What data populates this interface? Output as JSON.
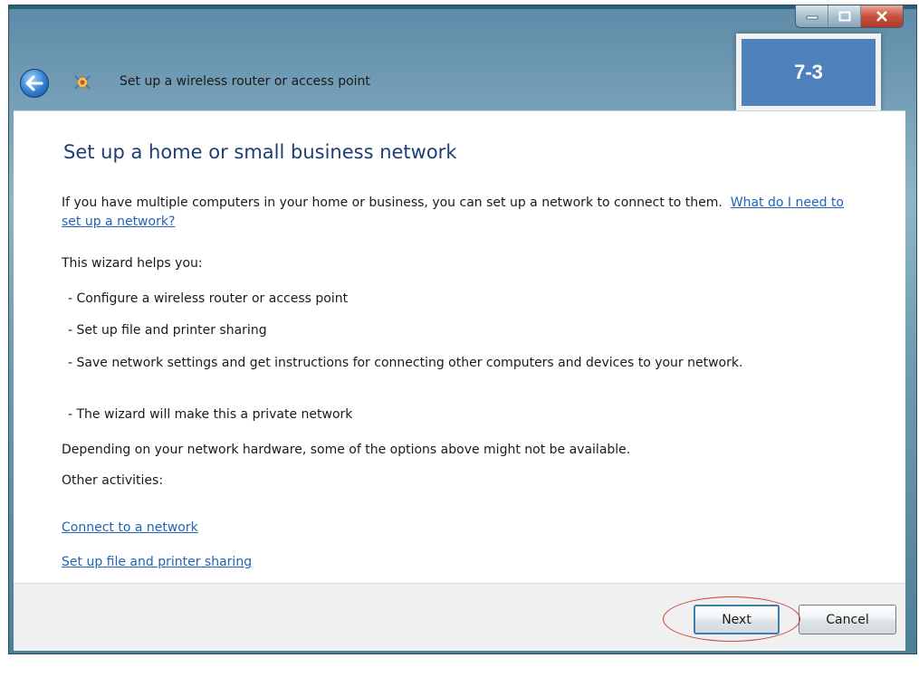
{
  "window": {
    "title": "Set up a wireless router or access point",
    "badge_label": "7-3"
  },
  "content": {
    "heading": "Set up a home or small business network",
    "intro": "If you have multiple computers in your home or business, you can set up a network to connect to them.",
    "intro_link": "What do I need to set up a network?",
    "helps_label": "This wizard helps you:",
    "bullets": [
      "- Configure a wireless router or access point",
      "- Set up file and printer sharing",
      "- Save network settings and get instructions for connecting other computers and devices to your network.",
      "- The wizard will make this a private network"
    ],
    "note": "Depending on your network hardware, some of the options above might not be available.",
    "other_label": "Other activities:",
    "other_links": [
      "Connect to a network",
      "Set up file and printer sharing"
    ]
  },
  "footer": {
    "next_label": "Next",
    "cancel_label": "Cancel"
  },
  "colors": {
    "heading": "#1e3f74",
    "link": "#1f64b8",
    "badge": "#4f81bd",
    "annotation": "#c8413a"
  },
  "icons": [
    "minimize-icon",
    "maximize-icon",
    "close-icon",
    "back-arrow-icon",
    "network-wizard-icon"
  ]
}
